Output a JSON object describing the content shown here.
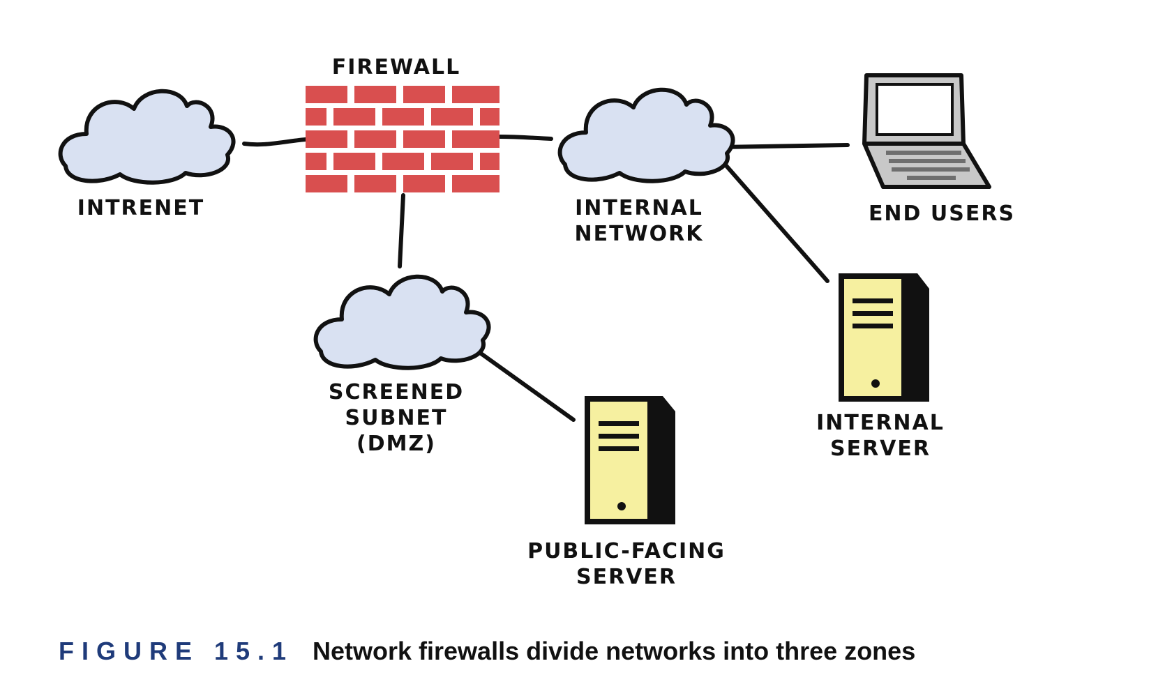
{
  "colors": {
    "cloud_fill": "#d9e1f2",
    "brick_red": "#d94f4f",
    "server_fill": "#f6f0a0",
    "laptop_screen": "#ffffff",
    "laptop_body": "#c8c8c8",
    "caption_blue": "#1f3b7a",
    "line": "#111111"
  },
  "nodes": {
    "internet": {
      "label": "INTRENET",
      "icon": "cloud-icon"
    },
    "firewall": {
      "label": "FIREWALL",
      "icon": "brick-wall-icon"
    },
    "internal_network": {
      "label_line1": "INTERNAL",
      "label_line2": "NETWORK",
      "icon": "cloud-icon"
    },
    "end_users": {
      "label": "END USERS",
      "icon": "laptop-icon"
    },
    "screened_subnet": {
      "label_line1": "SCREENED",
      "label_line2": "SUBNET",
      "label_line3": "(DMZ)",
      "icon": "cloud-icon"
    },
    "internal_server": {
      "label_line1": "INTERNAL",
      "label_line2": "SERVER",
      "icon": "server-icon"
    },
    "public_server": {
      "label_line1": "PUBLIC-FACING",
      "label_line2": "SERVER",
      "icon": "server-icon"
    }
  },
  "caption": {
    "number": "FIGURE 15.1",
    "text": "Network firewalls divide networks into three zones"
  }
}
